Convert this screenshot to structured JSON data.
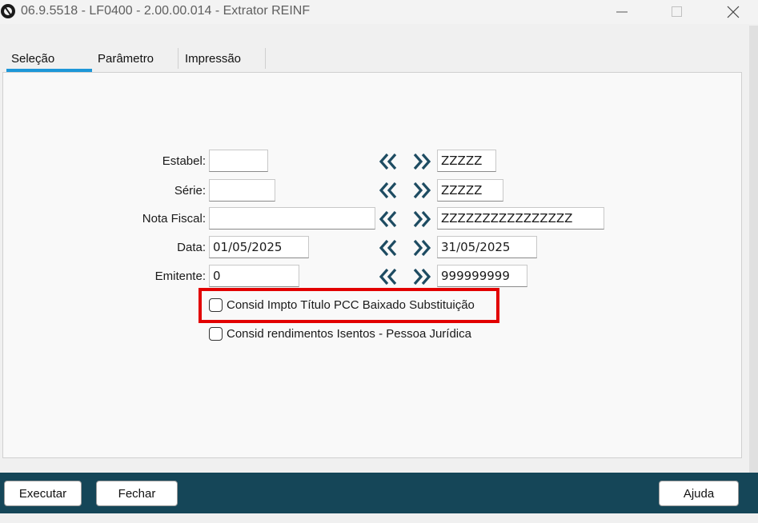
{
  "window": {
    "title": "06.9.5518 - LF0400 - 2.00.00.014 - Extrator REINF"
  },
  "tabs": [
    {
      "label": "Seleção",
      "active": true
    },
    {
      "label": "Parâmetro",
      "active": false
    },
    {
      "label": "Impressão",
      "active": false
    }
  ],
  "form": {
    "estabel": {
      "label": "Estabel:",
      "from": "",
      "to": "ZZZZZ"
    },
    "serie": {
      "label": "Série:",
      "from": "",
      "to": "ZZZZZ"
    },
    "nota_fiscal": {
      "label": "Nota Fiscal:",
      "from": "",
      "to": "ZZZZZZZZZZZZZZZZ"
    },
    "data": {
      "label": "Data:",
      "from": "01/05/2025",
      "to": "31/05/2025"
    },
    "emitente": {
      "label": "Emitente:",
      "from": "0",
      "to": "999999999"
    }
  },
  "checkboxes": [
    {
      "label": "Consid Impto Título PCC Baixado Substituição",
      "checked": false,
      "highlighted": true
    },
    {
      "label": "Consid rendimentos Isentos - Pessoa Jurídica",
      "checked": false,
      "highlighted": false
    }
  ],
  "buttons": {
    "executar": "Executar",
    "fechar": "Fechar",
    "ajuda": "Ajuda"
  },
  "colors": {
    "accent": "#1d97d8",
    "footer": "#154658",
    "highlight": "#e20000",
    "chevron": "#1e4c62"
  },
  "icons": {
    "range_from": "double-chevron-left-icon",
    "range_to": "double-chevron-right-icon"
  }
}
